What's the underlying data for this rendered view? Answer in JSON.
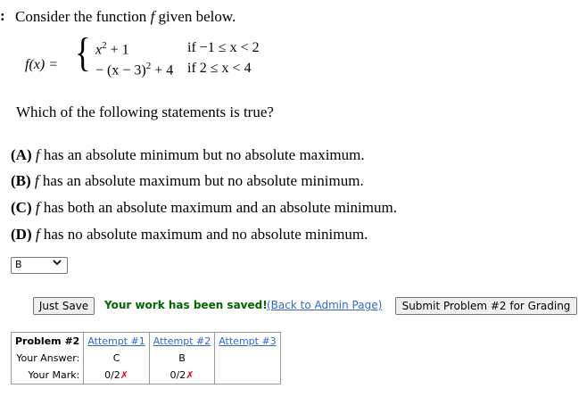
{
  "problem": {
    "bullet": ":",
    "prompt_prefix": "Consider the function ",
    "prompt_var": "f",
    "prompt_suffix": " given below.",
    "fx_label": "f(x) =",
    "case1_expr_base": "x",
    "case1_expr_exp": "2",
    "case1_expr_rest": " + 1",
    "case2_expr_base": "− (x − 3)",
    "case2_expr_exp": "2",
    "case2_expr_rest": " + 4",
    "cond1": "if  −1 ≤ x < 2",
    "cond2": "if   2 ≤ x < 4",
    "question": "Which of the following statements is true?"
  },
  "choices": [
    {
      "letter": "(A)",
      "var": "f",
      "text": " has an absolute minimum but no absolute maximum."
    },
    {
      "letter": "(B)",
      "var": "f",
      "text": " has an absolute maximum but no absolute minimum."
    },
    {
      "letter": "(C)",
      "var": "f",
      "text": " has both an absolute maximum and an absolute minimum."
    },
    {
      "letter": "(D)",
      "var": "f",
      "text": " has no absolute maximum and no absolute minimum."
    }
  ],
  "answer_select": {
    "value": "B"
  },
  "actions": {
    "save_label": "Just Save",
    "saved_message": "Your work has been saved!",
    "admin_link": "(Back to Admin Page)",
    "submit_label": "Submit Problem #2 for Grading"
  },
  "attempts": {
    "problem_label": "Problem #2",
    "attempt1_label": "Attempt #1",
    "attempt2_label": "Attempt #2",
    "attempt3_label": "Attempt #3",
    "your_answer_label": "Your Answer:",
    "your_mark_label": "Your Mark:",
    "answer1": "C",
    "answer2": "B",
    "mark1": "0/2",
    "mark2": "0/2",
    "mark_x": "✗"
  },
  "colors": {
    "saved_green": "#006600",
    "link_blue": "#3366cc",
    "wrong_red": "#dd0000"
  }
}
